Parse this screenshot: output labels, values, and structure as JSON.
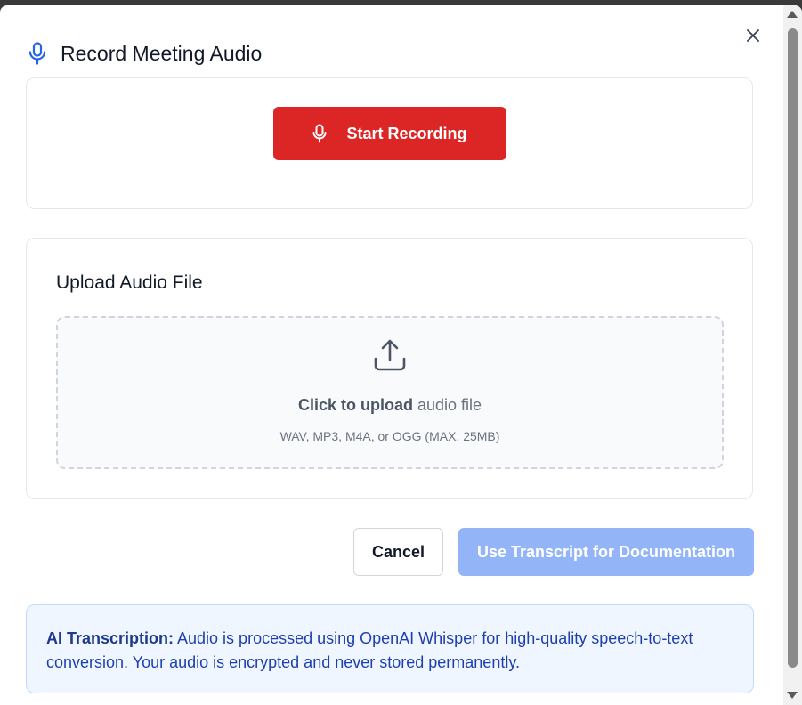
{
  "modal": {
    "title": "Record Meeting Audio",
    "title_icon": "microphone-icon",
    "close_icon": "close-icon"
  },
  "recording": {
    "button_label": "Start Recording",
    "button_icon": "microphone-icon",
    "button_color": "#dc2626"
  },
  "upload": {
    "heading": "Upload Audio File",
    "icon": "upload-icon",
    "click_text": "Click to upload",
    "rest_text": " audio file",
    "formats": "WAV, MP3, M4A, or OGG (MAX. 25MB)"
  },
  "actions": {
    "cancel_label": "Cancel",
    "use_label": "Use Transcript for Documentation",
    "use_disabled_color": "#93b4f7"
  },
  "info": {
    "label": "AI Transcription:",
    "text": " Audio is processed using OpenAI Whisper for high-quality speech-to-text conversion. Your audio is encrypted and never stored permanently."
  },
  "colors": {
    "accent_blue": "#2563eb",
    "info_bg": "#eff6ff",
    "info_text": "#1e40af"
  }
}
